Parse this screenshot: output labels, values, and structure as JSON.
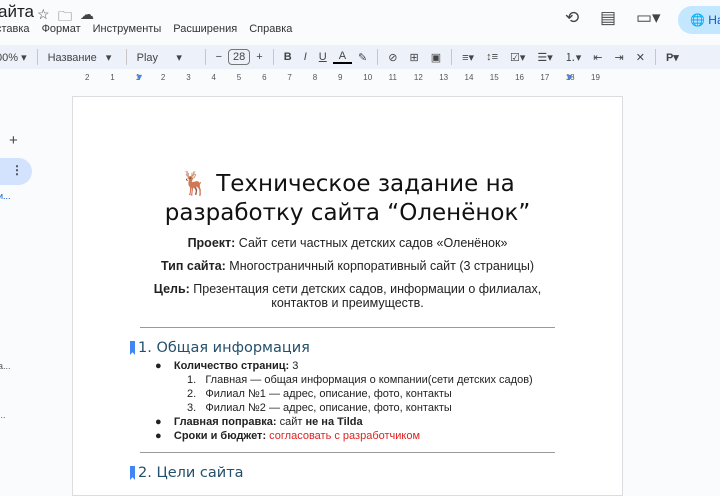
{
  "app": {
    "doc_title": "айта",
    "menu": [
      "ставка",
      "Формат",
      "Инструменты",
      "Расширения",
      "Справка"
    ],
    "share_label": "На"
  },
  "toolbar": {
    "zoom": "00%",
    "style": "Название",
    "font": "Play",
    "font_size": "28"
  },
  "ruler": {
    "ticks": [
      "2",
      "1",
      "1",
      "2",
      "3",
      "4",
      "5",
      "6",
      "7",
      "8",
      "9",
      "10",
      "11",
      "12",
      "13",
      "14",
      "15",
      "16",
      "17",
      "18",
      "19"
    ]
  },
  "sidebar": {
    "item1": "и...",
    "item2": "а...",
    "item3": "..."
  },
  "document": {
    "emoji": "🦌",
    "title_line1": "Техническое задание на",
    "title_line2": "разработку сайта “Оленёнок”",
    "project_label": "Проект:",
    "project_value": " Сайт сети частных детских садов «Оленёнок»",
    "type_label": "Тип сайта:",
    "type_value": " Многостраничный корпоративный сайт (3 страницы)",
    "goal_label": "Цель:",
    "goal_value": " Презентация сети детских садов, информации о филиалах,",
    "goal_value2": "контактов и преимуществ.",
    "section1": "1. Общая информация",
    "pages_label": "Количество страниц:",
    "pages_value": " 3",
    "pages": [
      "Главная — общая информация о компании(сети детских садов)",
      "Филиал №1 — адрес, описание, фото, контакты",
      "Филиал №2 — адрес, описание, фото, контакты"
    ],
    "fix_label": "Главная поправка:",
    "fix_mid": " сайт ",
    "fix_bold": "не на Tilda",
    "budget_label": "Сроки и бюджет:",
    "budget_value": " согласовать с разработчиком",
    "section2": "2. Цели сайта"
  }
}
